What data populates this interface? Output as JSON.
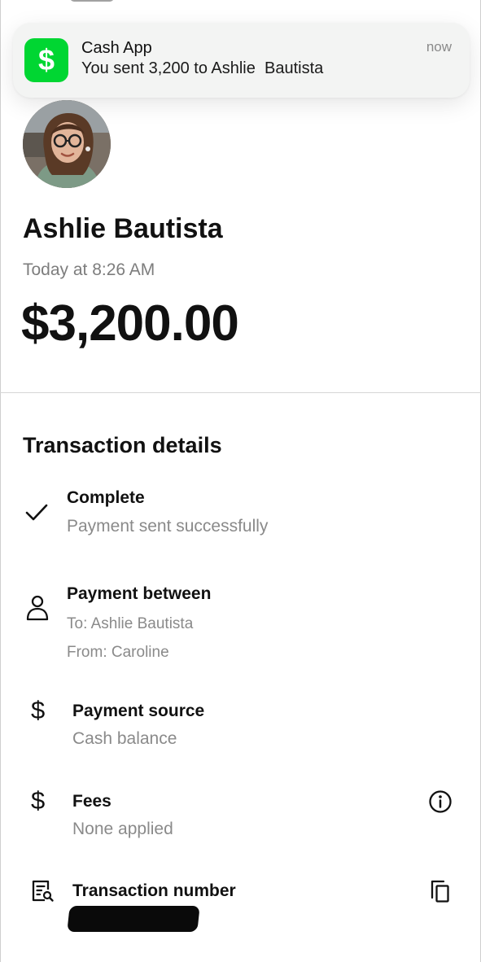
{
  "notification": {
    "app_name": "Cash App",
    "message": "You sent 3,200 to Ashlie  Bautista",
    "time": "now",
    "icon": "cash-app-dollar-icon",
    "accent_color": "#00d632"
  },
  "recipient": {
    "name": "Ashlie Bautista",
    "avatar": "profile-photo"
  },
  "transaction": {
    "time": "Today at 8:26 AM",
    "amount": "$3,200.00"
  },
  "details": {
    "title": "Transaction details",
    "status": {
      "icon": "checkmark-icon",
      "title": "Complete",
      "subtitle": "Payment sent successfully"
    },
    "payment_between": {
      "icon": "person-icon",
      "title": "Payment between",
      "to": "To: Ashlie Bautista",
      "from": "From: Caroline"
    },
    "payment_source": {
      "icon": "dollar-icon",
      "symbol": "$",
      "title": "Payment source",
      "subtitle": "Cash balance"
    },
    "fees": {
      "icon": "dollar-icon",
      "symbol": "$",
      "title": "Fees",
      "subtitle": "None applied",
      "action_icon": "info-icon"
    },
    "transaction_number": {
      "icon": "receipt-search-icon",
      "title": "Transaction number",
      "action_icon": "copy-icon"
    }
  }
}
